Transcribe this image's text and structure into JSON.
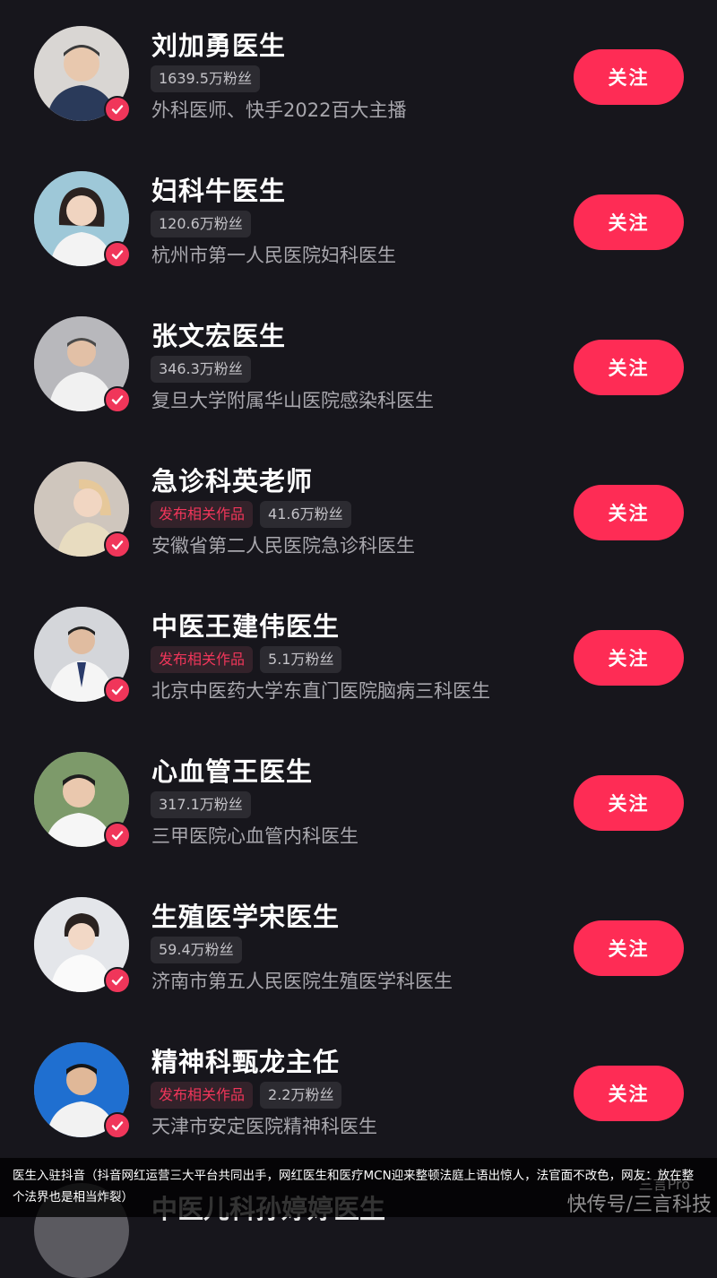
{
  "accent_color": "#fe2c55",
  "verified_icon": "checkmark-icon",
  "follow_label": "关注",
  "doctors": [
    {
      "name": "刘加勇医生",
      "works": "",
      "fans": "1639.5万粉丝",
      "desc": "外科医师、快手2022百大主播"
    },
    {
      "name": "妇科牛医生",
      "works": "",
      "fans": "120.6万粉丝",
      "desc": "杭州市第一人民医院妇科医生"
    },
    {
      "name": "张文宏医生",
      "works": "",
      "fans": "346.3万粉丝",
      "desc": "复旦大学附属华山医院感染科医生"
    },
    {
      "name": "急诊科英老师",
      "works": "发布相关作品",
      "fans": "41.6万粉丝",
      "desc": "安徽省第二人民医院急诊科医生"
    },
    {
      "name": "中医王建伟医生",
      "works": "发布相关作品",
      "fans": "5.1万粉丝",
      "desc": "北京中医药大学东直门医院脑病三科医生"
    },
    {
      "name": "心血管王医生",
      "works": "",
      "fans": "317.1万粉丝",
      "desc": "三甲医院心血管内科医生"
    },
    {
      "name": "生殖医学宋医生",
      "works": "",
      "fans": "59.4万粉丝",
      "desc": "济南市第五人民医院生殖医学科医生"
    },
    {
      "name": "精神科甄龙主任",
      "works": "发布相关作品",
      "fans": "2.2万粉丝",
      "desc": "天津市安定医院精神科医生"
    }
  ],
  "partial_next": {
    "name": "中医儿科孙婷婷医生"
  },
  "caption": "医生入驻抖音（抖音网红运营三大平台共同出手，网红医生和医疗MCN迎来整顿法庭上语出惊人，法官面不改色，网友：放在整个法界也是相当炸裂）",
  "watermark": "快传号/三言科技",
  "watermark_small": "三言Pro"
}
